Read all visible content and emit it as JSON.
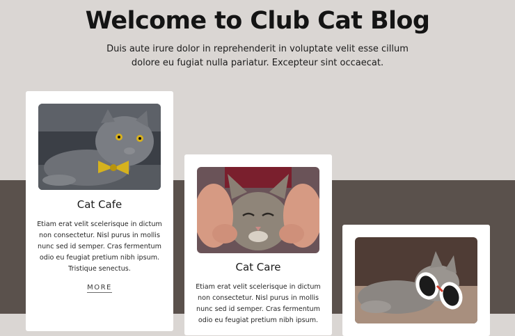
{
  "hero": {
    "title": "Welcome to Club Cat Blog",
    "subtitle": "Duis aute irure dolor in reprehenderit in voluptate velit esse cillum dolore eu fugiat nulla pariatur. Excepteur sint occaecat."
  },
  "cards": [
    {
      "title": "Cat Cafe",
      "text": "Etiam erat velit scelerisque in dictum non consectetur. Nisl purus in mollis nunc sed id semper. Cras fermentum odio eu feugiat pretium nibh ipsum. Tristique senectus.",
      "link": "MORE",
      "image": "gray-cat-with-bowtie"
    },
    {
      "title": "Cat Care",
      "text": "Etiam erat velit scelerisque in dictum non consectetur. Nisl purus in mollis nunc sed id semper. Cras fermentum odio eu feugiat pretium nibh ipsum.",
      "image": "kitten-face-held-in-hands"
    },
    {
      "image": "cat-with-sunglasses"
    }
  ],
  "colors": {
    "background": "#dad6d3",
    "dark_band": "#5a514c",
    "card": "#ffffff"
  }
}
